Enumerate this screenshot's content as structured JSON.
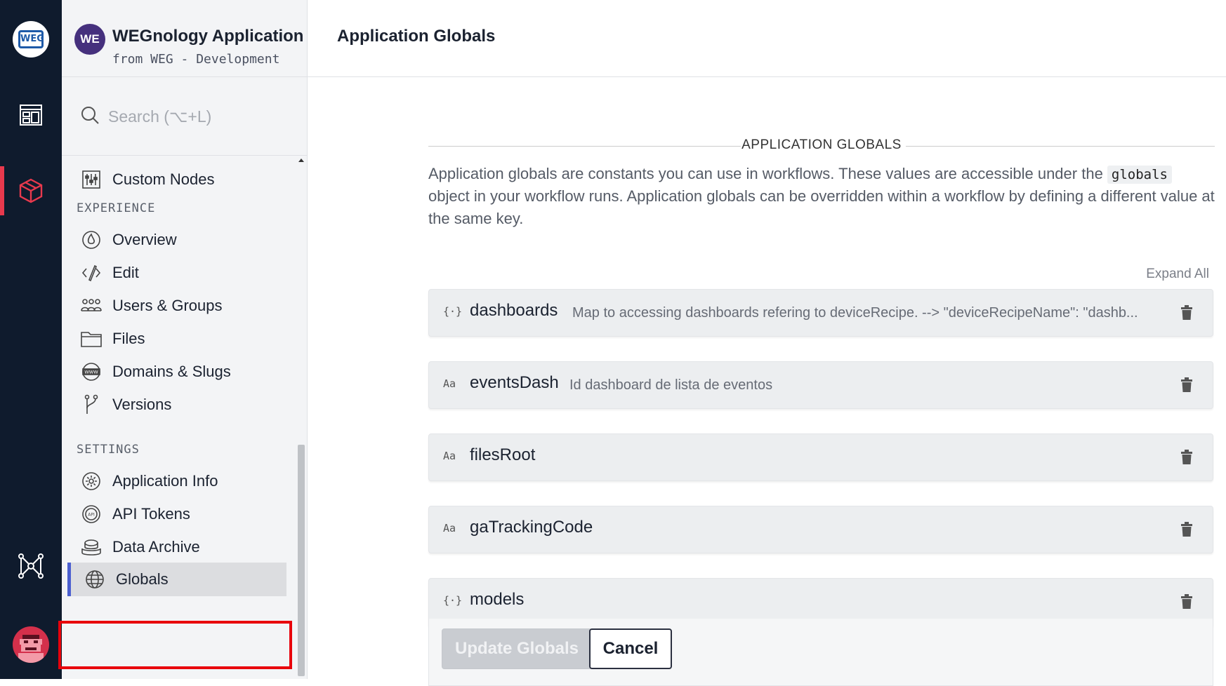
{
  "rail": {
    "logo_text": "WEG",
    "items": [
      {
        "icon": "dashboard-icon"
      },
      {
        "icon": "application-cube-icon",
        "active": true
      },
      {
        "icon": "network-nodes-icon"
      },
      {
        "icon": "user-avatar-icon"
      }
    ],
    "accent_color": "#e8394d"
  },
  "sidebar": {
    "app_initials": "WE",
    "app_name": "WEGnology Application",
    "app_subtitle": "from WEG - Development",
    "search_placeholder": "Search (⌥+L)",
    "top_item": {
      "label": "Custom Nodes",
      "icon": "sliders-icon"
    },
    "sections": [
      {
        "title": "EXPERIENCE",
        "items": [
          {
            "label": "Overview",
            "icon": "flame-icon"
          },
          {
            "label": "Edit",
            "icon": "code-pencil-icon"
          },
          {
            "label": "Users & Groups",
            "icon": "users-icon"
          },
          {
            "label": "Files",
            "icon": "folder-icon"
          },
          {
            "label": "Domains & Slugs",
            "icon": "www-globe-icon"
          },
          {
            "label": "Versions",
            "icon": "branch-icon"
          }
        ]
      },
      {
        "title": "SETTINGS",
        "items": [
          {
            "label": "Application Info",
            "icon": "gear-icon"
          },
          {
            "label": "API Tokens",
            "icon": "api-token-icon"
          },
          {
            "label": "Data Archive",
            "icon": "archive-icon"
          },
          {
            "label": "Globals",
            "icon": "globe-icon",
            "selected": true
          }
        ]
      }
    ]
  },
  "header": {
    "title": "Application Globals"
  },
  "main": {
    "section_title": "APPLICATION GLOBALS",
    "description_before": "Application globals are constants you can use in workflows. These values are accessible under the ",
    "description_code": "globals",
    "description_after": " object in your workflow runs. Application globals can be overridden within a workflow by defining a different value at the same key.",
    "expand_all": "Expand All",
    "globals": [
      {
        "type": "{·}",
        "name": "dashboards",
        "description": "Map to accessing dashboards refering to deviceRecipe. --> \"deviceRecipeName\": \"dashb..."
      },
      {
        "type": "Aa",
        "name": "eventsDash",
        "description": "Id dashboard de lista de eventos"
      },
      {
        "type": "Aa",
        "name": "filesRoot",
        "description": ""
      },
      {
        "type": "Aa",
        "name": "gaTrackingCode",
        "description": ""
      },
      {
        "type": "{·}",
        "name": "models",
        "description": ""
      }
    ],
    "update_button": "Update Globals",
    "cancel_button": "Cancel"
  }
}
